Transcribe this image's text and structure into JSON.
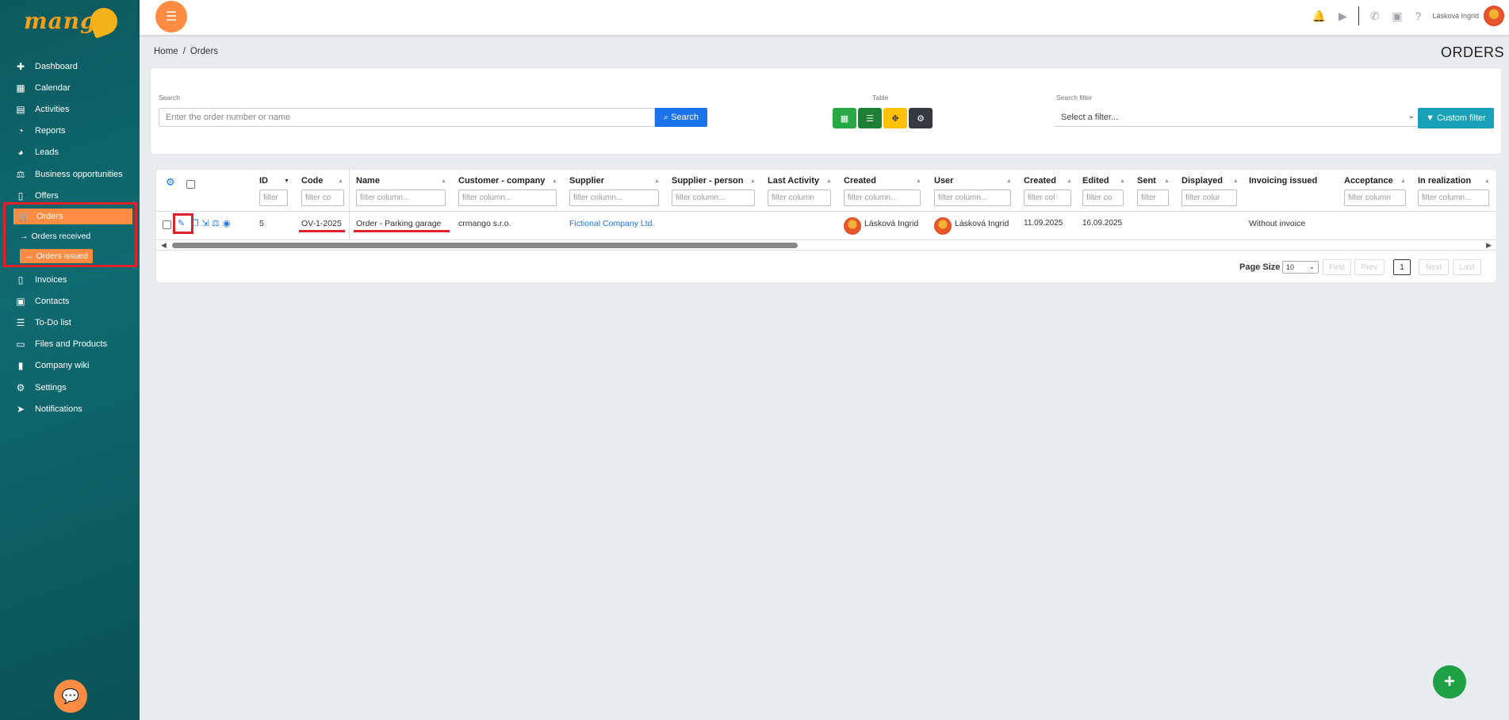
{
  "app": {
    "logo_text": "mango"
  },
  "sidebar": {
    "items": [
      {
        "label": "Dashboard",
        "icon": "puzzle-icon"
      },
      {
        "label": "Calendar",
        "icon": "calendar-icon"
      },
      {
        "label": "Activities",
        "icon": "activities-icon"
      },
      {
        "label": "Reports",
        "icon": "chart-pie-icon"
      },
      {
        "label": "Leads",
        "icon": "leads-icon"
      },
      {
        "label": "Business opportunities",
        "icon": "scale-icon"
      },
      {
        "label": "Offers",
        "icon": "document-icon"
      }
    ],
    "orders": {
      "label": "Orders",
      "sub_received": "Orders received",
      "sub_issued": "Orders issued"
    },
    "items_after": [
      {
        "label": "Invoices",
        "icon": "invoice-icon"
      },
      {
        "label": "Contacts",
        "icon": "contact-card-icon"
      },
      {
        "label": "To-Do list",
        "icon": "checklist-icon"
      },
      {
        "label": "Files and Products",
        "icon": "folder-icon"
      },
      {
        "label": "Company wiki",
        "icon": "book-icon"
      },
      {
        "label": "Settings",
        "icon": "gears-icon"
      },
      {
        "label": "Notifications",
        "icon": "paper-plane-icon"
      }
    ]
  },
  "topbar": {
    "user_name": "Lásková Ingrid"
  },
  "breadcrumb": {
    "home": "Home",
    "sep": "/",
    "current": "Orders"
  },
  "page_title": "ORDERS",
  "search": {
    "label": "Search",
    "placeholder": "Enter the order number or name",
    "button": "Search",
    "table_label": "Table",
    "filter_label": "Search filter",
    "filter_value": "Select a filter...",
    "custom_button": "Custom filter"
  },
  "table": {
    "headers": {
      "id": "ID",
      "code": "Code",
      "name": "Name",
      "customer": "Customer - company",
      "supplier": "Supplier",
      "supplier_person": "Supplier - person",
      "last_activity": "Last Activity",
      "created": "Created",
      "user": "User",
      "created_date": "Created",
      "edited": "Edited",
      "sent": "Sent",
      "displayed": "Displayed",
      "invoicing": "Invoicing issued",
      "acceptance": "Acceptance",
      "in_realization": "In realization"
    },
    "filters": {
      "id": "filter",
      "code": "filter co",
      "name": "filter column...",
      "customer": "filter column...",
      "supplier": "filter column...",
      "supplier_person": "filter column...",
      "last_activity": "filter column",
      "created": "filter column...",
      "user": "filter column...",
      "created_date": "filter col",
      "edited": "filter co",
      "sent": "filter",
      "displayed": "filter colur",
      "acceptance": "filter column",
      "in_realization": "filter column..."
    },
    "row": {
      "id": "5",
      "code": "OV-1-2025",
      "name": "Order - Parking garage",
      "customer": "crmango s.r.o.",
      "supplier": "Fictional Company Ltd.",
      "created_by": "Lásková Ingrid",
      "user": "Lásková Ingrid",
      "created_date": "11.09.2025",
      "edited": "16.09.2025",
      "invoicing": "Without invoice"
    }
  },
  "pager": {
    "label": "Page Size",
    "size": "10",
    "first": "First",
    "prev": "Prev",
    "page": "1",
    "next": "Next",
    "last": "Last"
  },
  "colors": {
    "accent": "#ff8c42",
    "primary": "#1a73e8",
    "highlight": "#e0202a",
    "sidebar": "#0e6b70"
  }
}
